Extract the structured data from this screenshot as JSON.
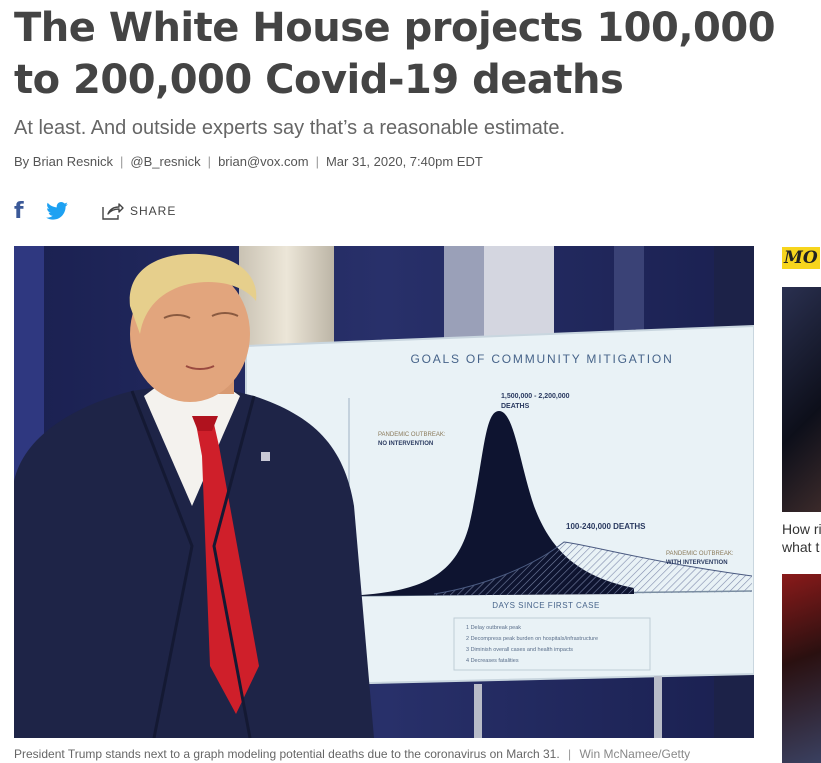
{
  "article": {
    "headline": "The White House projects 100,000 to 200,000 Covid-19 deaths",
    "dek": "At least. And outside experts say that’s a reasonable estimate.",
    "byline_prefix": "By",
    "author": "Brian Resnick",
    "twitter": "@B_resnick",
    "email": "brian@vox.com",
    "date": "Mar 31, 2020, 7:40pm EDT"
  },
  "share": {
    "facebook_glyph": "f",
    "share_label": "SHARE"
  },
  "photo": {
    "slide_title": "GOALS OF COMMUNITY MITIGATION",
    "peak_label_1": "1,500,000 - 2,200,000",
    "peak_label_2": "DEATHS",
    "no_int_1": "PANDEMIC OUTBREAK:",
    "no_int_2": "NO INTERVENTION",
    "with_deaths": "100-240,000 DEATHS",
    "with_int_1": "PANDEMIC OUTBREAK:",
    "with_int_2": "WITH INTERVENTION",
    "axis_label": "DAYS SINCE FIRST CASE",
    "goals": [
      "1  Delay outbreak peak",
      "2  Decompress peak burden on hospitals/infrastructure",
      "3  Diminish overall cases and health impacts",
      "4  Decreases fatalities"
    ],
    "caption": "President Trump stands next to a graph modeling potential deaths due to the coronavirus on March 31.",
    "caption_sep": "|",
    "credit": "Win McNamee/Getty"
  },
  "rail": {
    "tag": "MO",
    "story1_line1": "How ri",
    "story1_line2": "what t"
  },
  "colors": {
    "facebook": "#3b5998",
    "twitter": "#1da1f2",
    "rail_tag_bg": "#f7d51d",
    "tie": "#d0202a",
    "suit": "#1e2447"
  }
}
